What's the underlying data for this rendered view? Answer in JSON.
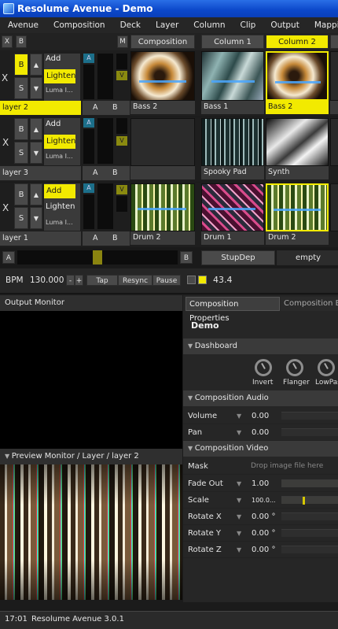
{
  "app": {
    "title": "Resolume Avenue - Demo"
  },
  "menu": [
    "Avenue",
    "Composition",
    "Deck",
    "Layer",
    "Column",
    "Clip",
    "Output",
    "Mapping"
  ],
  "header": {
    "x": "X",
    "b": "B",
    "m": "M",
    "composition_label": "Composition",
    "columns": [
      "Column 1",
      "Column 2"
    ]
  },
  "layers": [
    {
      "name": "layer 2",
      "blend_options": [
        "Add",
        "Lighten",
        "Luma I..."
      ],
      "selected_blend": "Lighten",
      "clips": [
        "Bass 2",
        "Bass 1",
        "Bass 2"
      ]
    },
    {
      "name": "layer 3",
      "blend_options": [
        "Add",
        "Lighten",
        "Luma I..."
      ],
      "selected_blend": "Lighten",
      "clips": [
        "",
        "Spooky Pad",
        "Synth"
      ]
    },
    {
      "name": "layer 1",
      "blend_options": [
        "Add",
        "Lighten",
        "Luma I..."
      ],
      "selected_blend": "Add",
      "clips": [
        "Drum 2",
        "Drum 1",
        "Drum 2"
      ]
    }
  ],
  "layer_controls": {
    "x": "X",
    "b": "B",
    "s": "S",
    "a": "A",
    "v": "V",
    "a_lbl": "A",
    "b_lbl": "B"
  },
  "crossfader": {
    "a": "A",
    "b": "B",
    "deck_name": "StupDep",
    "deck_empty": "empty"
  },
  "transport": {
    "bpm_label": "BPM",
    "bpm_value": "130.000",
    "minus": "-",
    "plus": "+",
    "tap": "Tap",
    "resync": "Resync",
    "pause": "Pause",
    "beat": "43.4"
  },
  "output_monitor": {
    "title": "Output Monitor"
  },
  "preview_monitor": {
    "title": "Preview Monitor / Layer / layer 2"
  },
  "tabs": [
    "Composition Properties",
    "Composition B"
  ],
  "comp": {
    "name": "Demo",
    "dashboard_title": "Dashboard",
    "knobs": [
      "Invert",
      "Flanger",
      "LowPas"
    ],
    "audio_title": "Composition Audio",
    "audio_params": [
      {
        "label": "Volume",
        "value": "0.00"
      },
      {
        "label": "Pan",
        "value": "0.00"
      }
    ],
    "video_title": "Composition Video",
    "mask_label": "Mask",
    "mask_placeholder": "Drop image file here",
    "video_params": [
      {
        "label": "Fade Out",
        "value": "1.00"
      },
      {
        "label": "Scale",
        "value": "100.0..."
      },
      {
        "label": "Rotate X",
        "value": "0.00 °"
      },
      {
        "label": "Rotate Y",
        "value": "0.00 °"
      },
      {
        "label": "Rotate Z",
        "value": "0.00 °"
      }
    ]
  },
  "status": {
    "time": "17:01",
    "version": "Resolume Avenue 3.0.1"
  },
  "colors": {
    "accent": "#f2ea00",
    "titlebar": "#0b47c9",
    "panel": "#262626"
  }
}
